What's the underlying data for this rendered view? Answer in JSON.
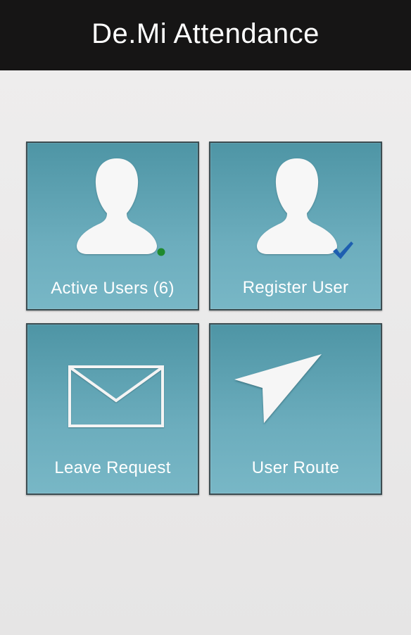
{
  "header": {
    "title": "De.Mi Attendance"
  },
  "tiles": [
    {
      "id": "active-users",
      "label": "Active Users (6)",
      "icon": "user-silhouette-icon",
      "badge": "online-dot-icon"
    },
    {
      "id": "register-user",
      "label": "Register User",
      "icon": "user-silhouette-icon",
      "badge": "checkmark-icon"
    },
    {
      "id": "leave-request",
      "label": "Leave Request",
      "icon": "envelope-icon"
    },
    {
      "id": "user-route",
      "label": "User Route",
      "icon": "navigation-arrow-icon"
    }
  ],
  "colors": {
    "header_bg": "#161515",
    "background": "#ebeaea",
    "tile_top": "#4e95a5",
    "tile_bottom": "#78b7c6",
    "tile_border": "#3c4d52",
    "online_dot": "#1f8a2e",
    "checkmark": "#1e5fb0",
    "text": "#ffffff"
  }
}
